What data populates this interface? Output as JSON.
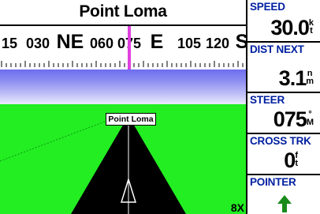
{
  "destination": {
    "name": "Point Loma"
  },
  "compass_tape": {
    "labels": [
      "15",
      "030",
      "NE",
      "060",
      "075",
      "E",
      "105",
      "120",
      "S"
    ],
    "current_heading": "075"
  },
  "highway": {
    "waypoint_label": "Point Loma",
    "zoom": "8X"
  },
  "fields": [
    {
      "label": "SPEED",
      "value": "30.0",
      "unit_top": "k",
      "unit_bottom": "t"
    },
    {
      "label": "DIST NEXT",
      "value": "3.1",
      "unit_top": "n",
      "unit_bottom": "m"
    },
    {
      "label": "STEER",
      "value": "075",
      "unit_top": "°",
      "unit_bottom": "M"
    },
    {
      "label": "CROSS TRK",
      "value": "0",
      "unit_top": "f",
      "unit_bottom": "t"
    },
    {
      "label": "POINTER",
      "value": ""
    }
  ],
  "colors": {
    "field_label": "#0020a0",
    "needle": "#e040e0",
    "ground": "#22ee22",
    "pointer_arrow": "#1a8a1a"
  }
}
